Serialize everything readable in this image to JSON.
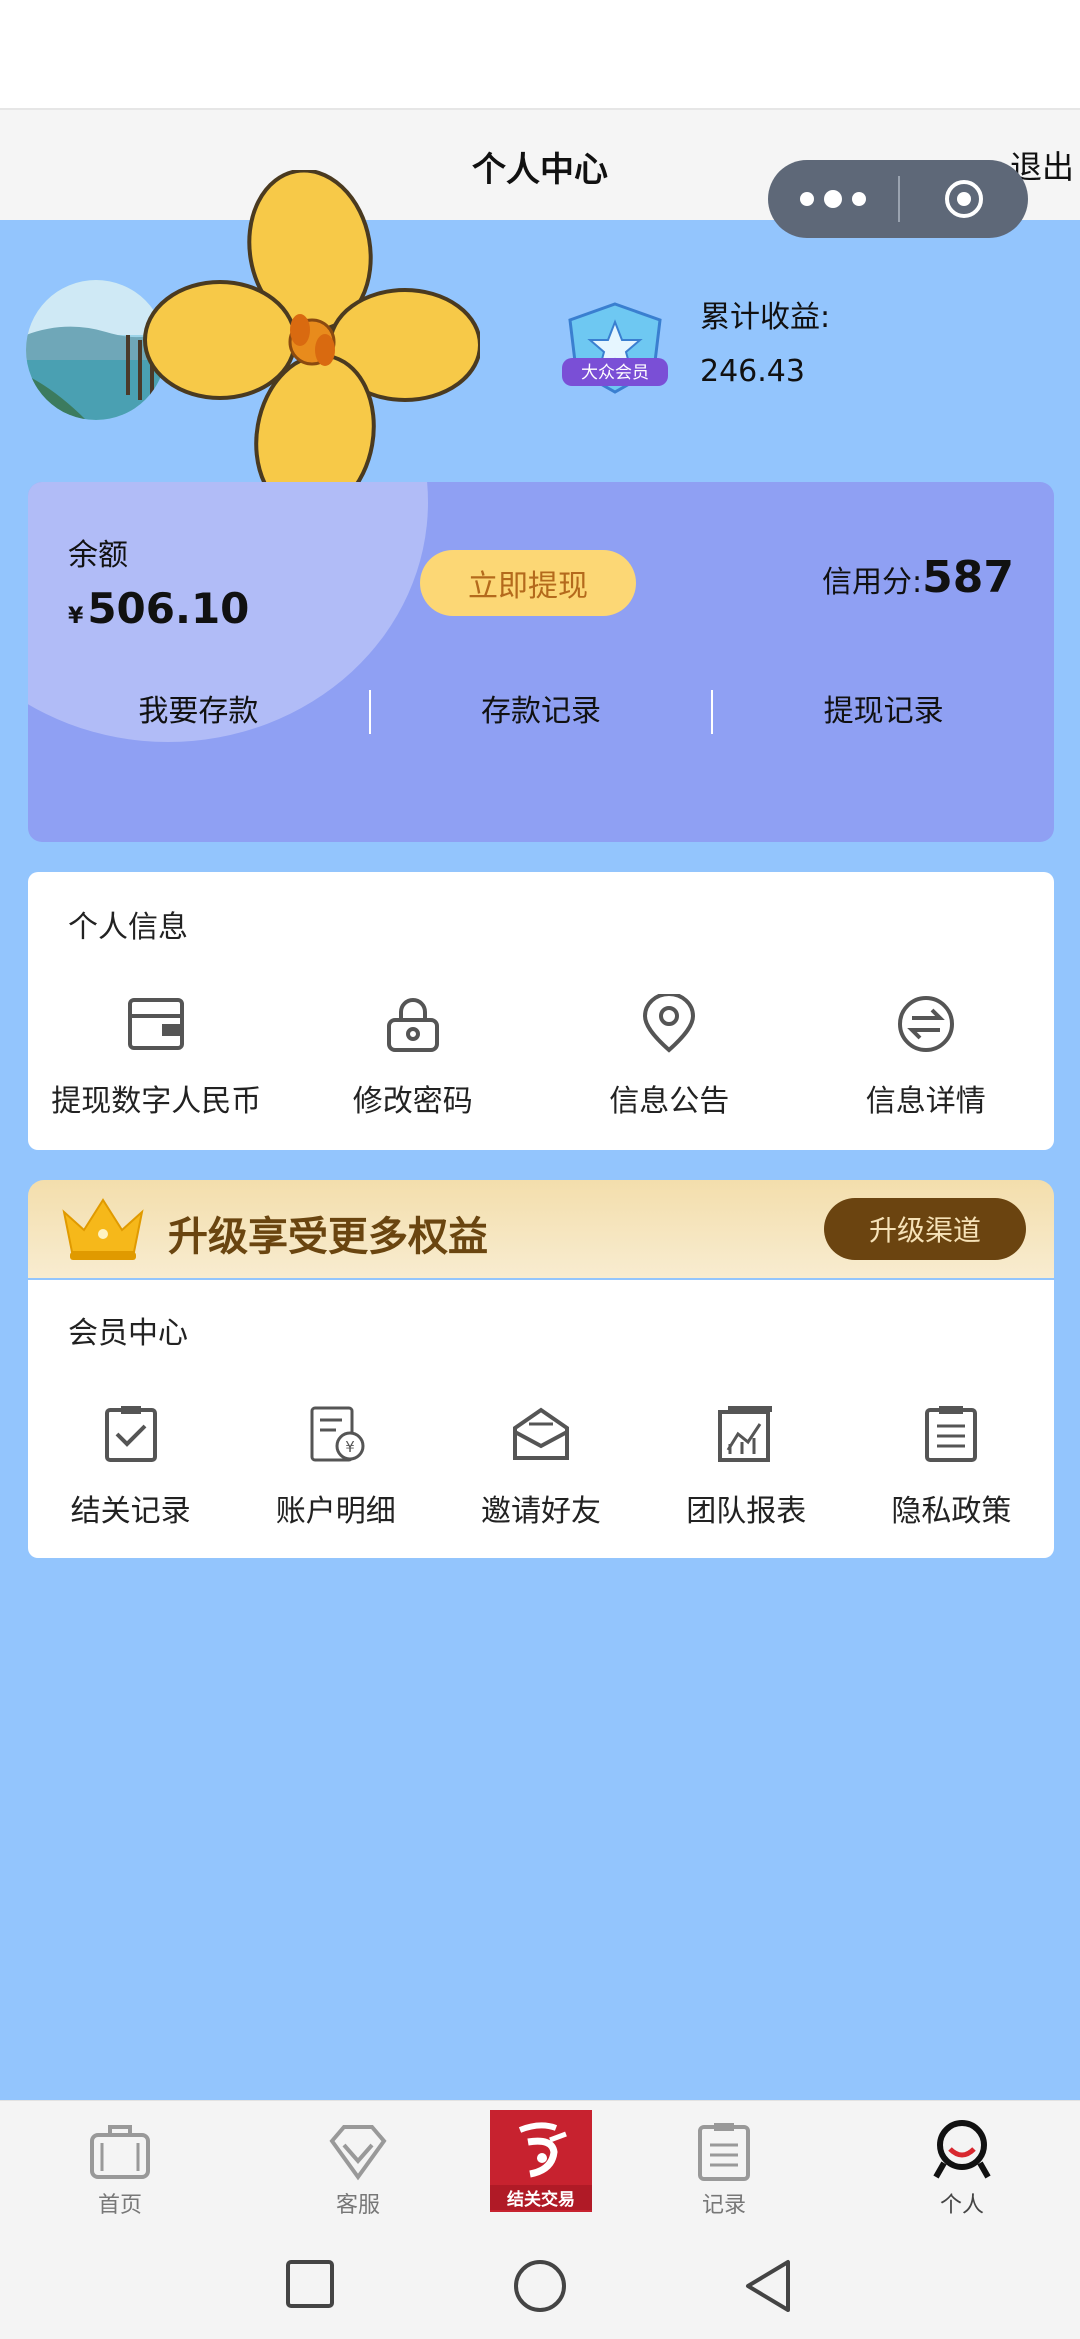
{
  "header": {
    "title": "个人中心",
    "logout_label": "退出"
  },
  "profile": {
    "earnings_label": "累计收益:",
    "earnings_value": "246.43",
    "badge_text": "大众会员"
  },
  "balance": {
    "label": "余额",
    "currency_symbol": "¥",
    "value": "506.10",
    "withdraw_label": "立即提现",
    "credit_label": "信用分:",
    "credit_value": "587",
    "links": [
      "我要存款",
      "存款记录",
      "提现记录"
    ]
  },
  "personal_info": {
    "title": "个人信息",
    "items": [
      {
        "label": "提现数字人民币",
        "icon": "wallet-icon"
      },
      {
        "label": "修改密码",
        "icon": "lock-icon"
      },
      {
        "label": "信息公告",
        "icon": "location-pin-icon"
      },
      {
        "label": "信息详情",
        "icon": "transfer-icon"
      }
    ]
  },
  "upgrade": {
    "text": "升级享受更多权益",
    "button_label": "升级渠道"
  },
  "member_center": {
    "title": "会员中心",
    "items": [
      {
        "label": "结关记录",
        "icon": "clipboard-check-icon"
      },
      {
        "label": "账户明细",
        "icon": "bill-icon"
      },
      {
        "label": "邀请好友",
        "icon": "mail-icon"
      },
      {
        "label": "团队报表",
        "icon": "chart-icon"
      },
      {
        "label": "隐私政策",
        "icon": "document-list-icon"
      }
    ]
  },
  "tabbar": {
    "items": [
      {
        "label": "首页",
        "icon": "suitcase-icon"
      },
      {
        "label": "客服",
        "icon": "diamond-icon"
      },
      {
        "label": "结关交易",
        "icon": "brand-logo-icon"
      },
      {
        "label": "记录",
        "icon": "clipboard-icon"
      },
      {
        "label": "个人",
        "icon": "person-icon"
      }
    ],
    "active": "个人"
  },
  "colors": {
    "page_bg": "#93c5fd",
    "card_bg": "#8fa0f3",
    "accent_yellow": "#fcd775",
    "upgrade_btn": "#6b4410",
    "logo_red": "#c7222f"
  }
}
